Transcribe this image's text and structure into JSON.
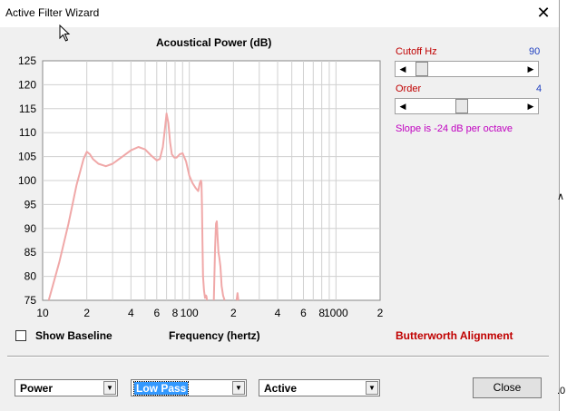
{
  "window": {
    "title": "Active Filter Wizard"
  },
  "icons": {
    "close": "close-icon",
    "cursor": "mouse-cursor-icon"
  },
  "chart_data": {
    "type": "line",
    "title": "Acoustical Power (dB)",
    "xlabel": "Frequency (hertz)",
    "xscale": "log",
    "xlim": [
      10,
      2000
    ],
    "ylim": [
      75,
      125
    ],
    "yticks": [
      75,
      80,
      85,
      90,
      95,
      100,
      105,
      110,
      115,
      120,
      125
    ],
    "yticklabels": [
      "75",
      "80",
      "85",
      "90",
      "95",
      "100",
      "105",
      "110",
      "115",
      "120",
      "125"
    ],
    "xticks": [
      10,
      20,
      40,
      60,
      80,
      100,
      200,
      400,
      600,
      800,
      1000,
      2000
    ],
    "xticklabels": [
      "10",
      "2",
      "4",
      "6",
      "8",
      "100",
      "2",
      "4",
      "6",
      "8",
      "1000",
      "2"
    ],
    "grid": true,
    "series": [
      {
        "color": "#f0a8a8",
        "x": [
          11,
          13,
          15,
          17,
          19,
          20,
          21,
          22,
          24,
          27,
          30,
          35,
          40,
          45,
          50,
          55,
          60,
          63,
          66,
          68,
          70,
          72,
          74,
          76,
          79,
          82,
          86,
          90,
          95,
          100,
          105,
          110,
          115,
          118,
          120,
          121,
          122,
          123,
          124,
          126,
          128,
          130,
          131,
          132
        ],
        "y": [
          75,
          83,
          91,
          99,
          104.5,
          106,
          105.5,
          104.5,
          103.5,
          103,
          103.5,
          105,
          106.3,
          107,
          106.5,
          105.2,
          104.2,
          104.5,
          107,
          110.5,
          114,
          112,
          108,
          105.5,
          104.8,
          104.8,
          105.5,
          105.7,
          104,
          101,
          99.5,
          98.5,
          97.8,
          99.5,
          100,
          99.5,
          95,
          87,
          80,
          77,
          75.5,
          76,
          75.8,
          75
        ]
      },
      {
        "color": "#f0a8a8",
        "x": [
          147,
          150,
          152,
          154,
          156,
          158,
          160,
          163,
          166,
          170,
          174
        ],
        "y": [
          75,
          86,
          91,
          91.5,
          88,
          85,
          84,
          82,
          78,
          76,
          75
        ]
      },
      {
        "color": "#f0a8a8",
        "x": [
          210,
          213,
          216
        ],
        "y": [
          75,
          76.5,
          75
        ]
      }
    ]
  },
  "controls": {
    "cutoff": {
      "label": "Cutoff  Hz",
      "value": "90",
      "level": 0.05
    },
    "order": {
      "label": "Order",
      "value": "4",
      "level": 0.45
    },
    "slope_text": "Slope is -24 dB per octave",
    "alignment": "Butterworth Alignment",
    "show_baseline": "Show Baseline",
    "show_baseline_checked": false
  },
  "dropdowns": [
    {
      "name": "mode",
      "value": "Power",
      "highlighted": false
    },
    {
      "name": "filter-type",
      "value": "Low Pass",
      "highlighted": true
    },
    {
      "name": "filter-kind",
      "value": "Active",
      "highlighted": false
    }
  ],
  "buttons": {
    "close": "Close"
  }
}
